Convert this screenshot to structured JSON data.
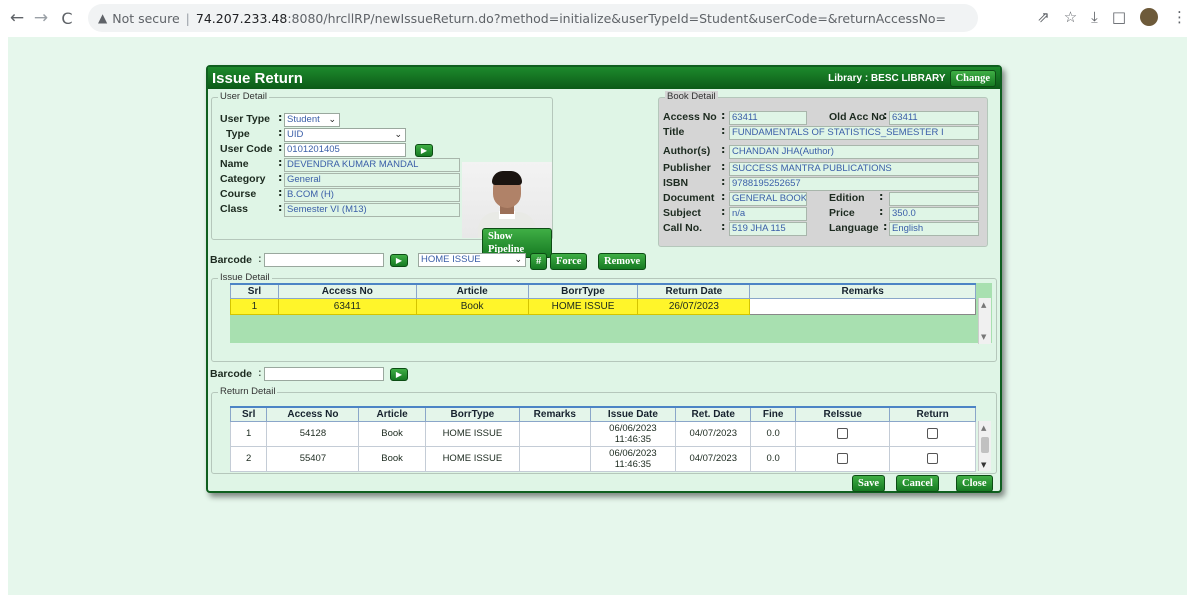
{
  "browser": {
    "back": "←",
    "forward": "→",
    "reload": "C",
    "warn": "▲",
    "security": "Not secure",
    "sep": "|",
    "host": "74.207.233.48",
    "path": ":8080/hrcllRP/newIssueReturn.do?method=initialize&userTypeId=Student&userCode=&returnAccessNo=",
    "icons": {
      "share": "⇗",
      "star": "☆",
      "download": "⤓",
      "sidebar": "□",
      "menu": "⋮"
    }
  },
  "dialog": {
    "title": "Issue Return",
    "library_label": "Library : BESC LIBRARY",
    "change_label": "Change"
  },
  "user": {
    "legend": "User Detail",
    "user_type_label": "User Type",
    "user_type_value": "Student",
    "type_label": "Type",
    "type_value": "UID",
    "user_code_label": "User Code",
    "user_code_value": "0101201405",
    "go_label": "▶",
    "name_label": "Name",
    "name_value": "DEVENDRA KUMAR MANDAL",
    "category_label": "Category",
    "category_value": "General",
    "course_label": "Course",
    "course_value": "B.COM (H)",
    "class_label": "Class",
    "class_value": "Semester VI (M13)",
    "show_pipeline": "Show Pipeline"
  },
  "book": {
    "legend": "Book Detail",
    "access_no_label": "Access No",
    "access_no_value": "63411",
    "old_acc_label": "Old Acc No",
    "old_acc_value": "63411",
    "title_label": "Title",
    "title_value": "FUNDAMENTALS OF STATISTICS_SEMESTER I",
    "author_label": "Author(s)",
    "author_value": "CHANDAN JHA(Author)",
    "publisher_label": "Publisher",
    "publisher_value": "SUCCESS MANTRA PUBLICATIONS",
    "isbn_label": "ISBN",
    "isbn_value": "9788195252657",
    "document_label": "Document",
    "document_value": "GENERAL BOOK",
    "edition_label": "Edition",
    "edition_value": "",
    "subject_label": "Subject",
    "subject_value": "n/a",
    "price_label": "Price",
    "price_value": "350.0",
    "callno_label": "Call No.",
    "callno_value": "519 JHA 115",
    "language_label": "Language",
    "language_value": "English"
  },
  "barcode_bar": {
    "label": "Barcode",
    "value": "",
    "go_label": "▶",
    "issue_type": "HOME ISSUE",
    "hash_label": "#",
    "force_label": "Force",
    "remove_label": "Remove"
  },
  "issue_detail": {
    "legend": "Issue Detail",
    "headers": [
      "Srl",
      "Access No",
      "Article",
      "BorrType",
      "Return Date",
      "Remarks"
    ],
    "rows": [
      {
        "srl": "1",
        "access_no": "63411",
        "article": "Book",
        "borr_type": "HOME ISSUE",
        "return_date": "26/07/2023",
        "remarks": ""
      }
    ]
  },
  "barcode_bar2": {
    "label": "Barcode",
    "value": "",
    "go_label": "▶"
  },
  "return_detail": {
    "legend": "Return Detail",
    "headers": [
      "Srl",
      "Access No",
      "Article",
      "BorrType",
      "Remarks",
      "Issue Date",
      "Ret. Date",
      "Fine",
      "ReIssue",
      "Return"
    ],
    "rows": [
      {
        "srl": "1",
        "access_no": "54128",
        "article": "Book",
        "borr_type": "HOME ISSUE",
        "remarks": "",
        "issue_date": "06/06/2023",
        "issue_time": "11:46:35",
        "ret_date": "04/07/2023",
        "fine": "0.0"
      },
      {
        "srl": "2",
        "access_no": "55407",
        "article": "Book",
        "borr_type": "HOME ISSUE",
        "remarks": "",
        "issue_date": "06/06/2023",
        "issue_time": "11:46:35",
        "ret_date": "04/07/2023",
        "fine": "0.0"
      }
    ]
  },
  "actions": {
    "save": "Save",
    "cancel": "Cancel",
    "close": "Close"
  }
}
